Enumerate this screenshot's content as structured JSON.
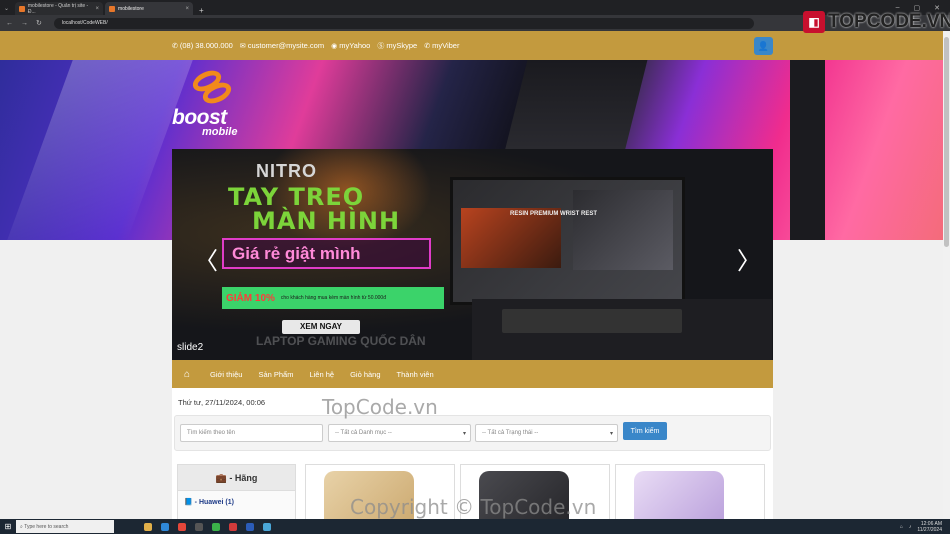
{
  "browser": {
    "tabs": [
      {
        "title": "mobilestore - Quản trị site - Đ...",
        "active": false
      },
      {
        "title": "mobilestore",
        "active": true
      }
    ],
    "url": "localhost/CodeWEB/"
  },
  "topbar": {
    "phone": "(08) 38.000.000",
    "email": "customer@mysite.com",
    "yahoo": "myYahoo",
    "skype": "mySkype",
    "viber": "myViber"
  },
  "logo": {
    "name": "boost",
    "sub": "mobile"
  },
  "slider": {
    "brand": "NITRO",
    "headline1": "TAY TREO",
    "headline2": "MÀN HÌNH",
    "highlight": "Giá rẻ giật mình",
    "discount": "GIẢM 10%",
    "promo_text": "cho khách hàng mua kèm màn hình từ 50.000đ",
    "product": "RESIN PREMIUM WRIST REST",
    "cta": "XEM NGAY",
    "footer_text": "LAPTOP GAMING QUỐC DÂN",
    "caption": "slide2"
  },
  "nav": {
    "items": [
      "Giới thiệu",
      "Sản Phẩm",
      "Liên hệ",
      "Giỏ hàng",
      "Thành viên"
    ]
  },
  "content": {
    "date": "Thứ tư, 27/11/2024, 00:06",
    "search_placeholder": "Tìm kiếm theo tên",
    "category_select": "-- Tất cả Danh mục --",
    "status_select": "-- Tất cả Trạng thái --",
    "search_button": "Tìm kiếm"
  },
  "sidebar": {
    "title": "- Hãng",
    "items": [
      "- Huawei (1)"
    ]
  },
  "watermarks": {
    "center": "TopCode.vn",
    "bottom": "Copyright © TopCode.vn",
    "logo": "TOPCODE.VN"
  },
  "taskbar": {
    "search": "Type here to search",
    "time": "12:06 AM",
    "date": "11/27/2024"
  }
}
